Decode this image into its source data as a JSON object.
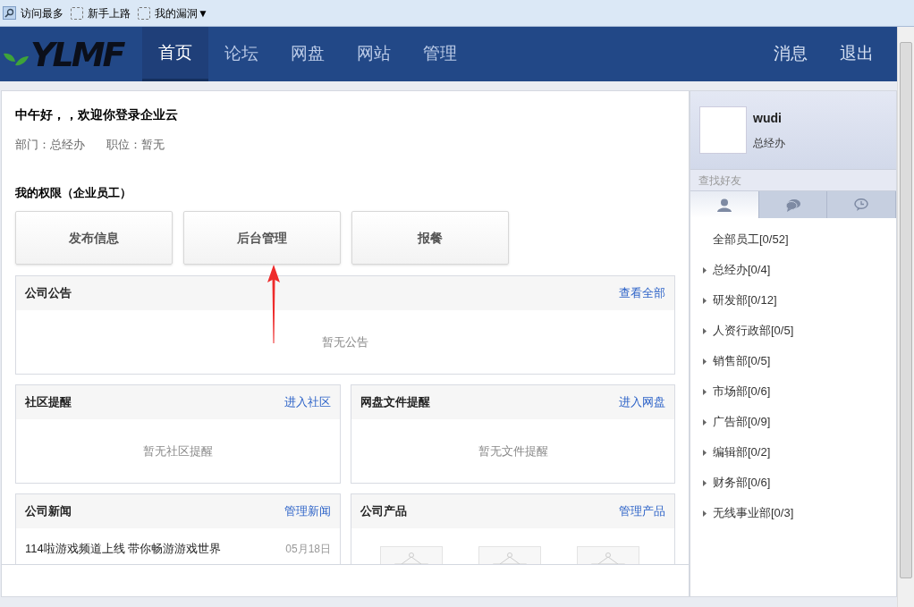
{
  "logo": "YLMF",
  "toolbar": [
    {
      "label": "访问最多",
      "kind": "search"
    },
    {
      "label": "新手上路",
      "kind": "blank"
    },
    {
      "label": "我的漏洞▼",
      "kind": "blank"
    }
  ],
  "nav": {
    "items": [
      {
        "label": "首页",
        "selected": true
      },
      {
        "label": "论坛",
        "selected": false
      },
      {
        "label": "网盘",
        "selected": false
      },
      {
        "label": "网站",
        "selected": false
      },
      {
        "label": "管理",
        "selected": false
      }
    ],
    "actions": [
      "消息",
      "退出"
    ]
  },
  "welcome": {
    "greeting": "中午好，，欢迎你登录企业云",
    "department": "部门：总经办",
    "position": "职位：暂无"
  },
  "permissions": {
    "title": "我的权限（企业员工）",
    "buttons": [
      "发布信息",
      "后台管理",
      "报餐"
    ]
  },
  "announcements": {
    "title": "公司公告",
    "link": "查看全部",
    "empty": "暂无公告"
  },
  "community": {
    "title": "社区提醒",
    "link": "进入社区",
    "empty": "暂无社区提醒"
  },
  "disk": {
    "title": "网盘文件提醒",
    "link": "进入网盘",
    "empty": "暂无文件提醒"
  },
  "news": {
    "title": "公司新闻",
    "link": "管理新闻",
    "items": [
      {
        "title": "114啦游戏频道上线 带你畅游游戏世界",
        "date": "05月18日"
      }
    ]
  },
  "products": {
    "title": "公司产品",
    "link": "管理产品"
  },
  "profile": {
    "name": "wudi",
    "department": "总经办"
  },
  "friend_search": {
    "placeholder": "查找好友"
  },
  "contact_tabs": [
    {
      "kind": "person",
      "selected": true
    },
    {
      "kind": "chat",
      "selected": false
    },
    {
      "kind": "history",
      "selected": false
    }
  ],
  "departments": [
    {
      "label": "全部员工[0/52]",
      "kind": "all"
    },
    {
      "label": "总经办[0/4]",
      "kind": "group",
      "expanded": false
    },
    {
      "label": "研发部[0/12]",
      "kind": "group",
      "expanded": false
    },
    {
      "label": "人资行政部[0/5]",
      "kind": "group",
      "expanded": false
    },
    {
      "label": "销售部[0/5]",
      "kind": "group",
      "expanded": false
    },
    {
      "label": "市场部[0/6]",
      "kind": "group",
      "expanded": false
    },
    {
      "label": "广告部[0/9]",
      "kind": "group",
      "expanded": false
    },
    {
      "label": "编辑部[0/2]",
      "kind": "group",
      "expanded": false
    },
    {
      "label": "财务部[0/6]",
      "kind": "group",
      "expanded": false
    },
    {
      "label": "无线事业部[0/3]",
      "kind": "group",
      "expanded": false
    }
  ]
}
